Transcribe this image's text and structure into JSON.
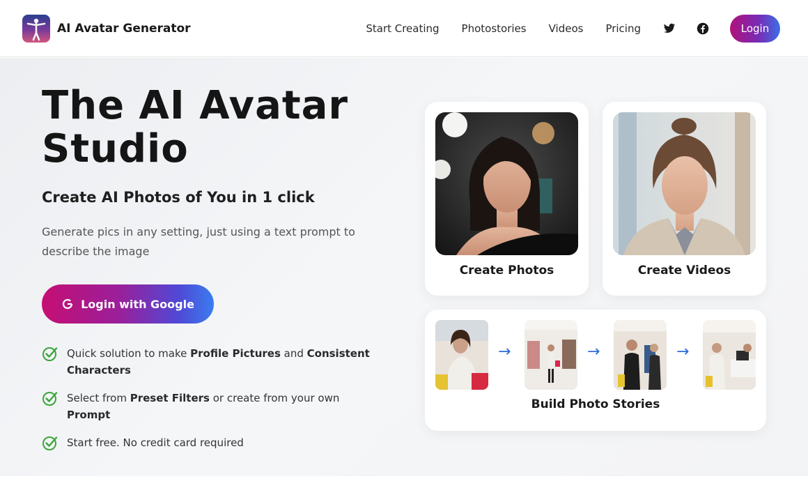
{
  "header": {
    "brand_name": "AI Avatar Generator",
    "nav": [
      "Start Creating",
      "Photostories",
      "Videos",
      "Pricing"
    ],
    "login_label": "Login"
  },
  "hero": {
    "title": "The AI Avatar Studio",
    "subtitle": "Create AI Photos of You in 1 click",
    "description": "Generate pics in any setting, just using a text prompt to describe the image",
    "google_button": "Login with Google",
    "features": [
      {
        "parts": [
          "Quick solution to make ",
          "Profile Pictures",
          " and ",
          "Consistent Characters"
        ]
      },
      {
        "parts": [
          "Select from ",
          "Preset Filters",
          " or create from your own ",
          "Prompt"
        ]
      },
      {
        "parts": [
          "Start free. No credit card required"
        ]
      }
    ]
  },
  "cards": {
    "photos_label": "Create Photos",
    "videos_label": "Create Videos",
    "stories_label": "Build Photo Stories",
    "arrow_glyph": "→"
  },
  "icons": {
    "twitter": "twitter-icon",
    "facebook": "facebook-icon",
    "google": "google-g-icon",
    "check": "check-circle-icon"
  },
  "colors": {
    "accent_start": "#b0127a",
    "accent_end": "#3b6fe6",
    "check_green": "#3aa53a",
    "arrow_blue": "#2f6cd8"
  }
}
